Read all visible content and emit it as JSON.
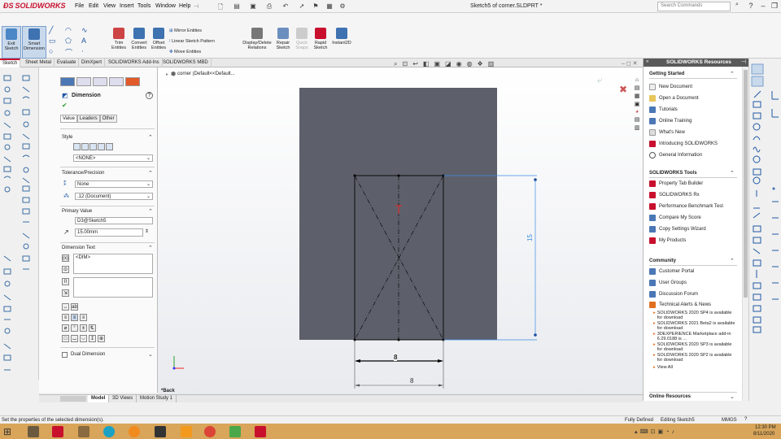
{
  "app": {
    "logo_text": "SOLIDWORKS",
    "menu": [
      "File",
      "Edit",
      "View",
      "Insert",
      "Tools",
      "Window",
      "Help"
    ],
    "document_title": "Sketch5 of corner.SLDPRT *",
    "search_placeholder": "Search Commands"
  },
  "ribbon": {
    "exit_sketch": "Exit Sketch",
    "smart_dimension": "Smart Dimension",
    "trim_entities": "Trim Entities",
    "convert_entities": "Convert Entities",
    "offset_entities": "Offset Entities",
    "mirror_entities": "Mirror Entities",
    "linear_pattern": "Linear Sketch Pattern",
    "move_entities": "Move Entities",
    "display_delete_relations": "Display/Delete Relations",
    "repair_sketch": "Repair Sketch",
    "quick_snaps": "Quick Snaps",
    "rapid_sketch": "Rapid Sketch",
    "instant2d": "Instant2D"
  },
  "cmd_tabs": [
    "Sketch",
    "Sheet Metal",
    "Evaluate",
    "DimXpert",
    "SOLIDWORKS Add-Ins",
    "SOLIDWORKS MBD"
  ],
  "tree_header": "corner (Default<<Default...",
  "property_manager": {
    "title": "Dimension",
    "tabs": [
      "Value",
      "Leaders",
      "Other"
    ],
    "style_label": "Style",
    "style_value": "<NONE>",
    "tolerance_label": "Tolerance/Precision",
    "tolerance_value": "None",
    "precision_value": ".12 (Document)",
    "primary_value_label": "Primary Value",
    "primary_name": "D3@Sketch5",
    "primary_value": "15.00mm",
    "dimension_text_label": "Dimension Text",
    "dim_text_value": "<DIM>",
    "dual_dimension_label": "Dual Dimension"
  },
  "sketch": {
    "dim_width_top": "8",
    "dim_width_bottom": "8",
    "dim_height": "15",
    "view_label": "*Back"
  },
  "bottom_tabs": [
    "Model",
    "3D Views",
    "Motion Study 1"
  ],
  "resources": {
    "title": "SOLIDWORKS Resources",
    "getting_started": {
      "heading": "Getting Started",
      "items": [
        "New Document",
        "Open a Document",
        "Tutorials",
        "Online Training",
        "What's New",
        "Introducing SOLIDWORKS",
        "General Information"
      ]
    },
    "tools": {
      "heading": "SOLIDWORKS Tools",
      "items": [
        "Property Tab Builder",
        "SOLIDWORKS Rx",
        "Performance Benchmark Test",
        "Compare My Score",
        "Copy Settings Wizard",
        "My Products"
      ]
    },
    "community": {
      "heading": "Community",
      "items": [
        "Customer Portal",
        "User Groups",
        "Discussion Forum",
        "Technical Alerts & News"
      ],
      "news": [
        "SOLIDWORKS 2020 SP4 is available for download",
        "SOLIDWORKS 2021 Beta2 is available for download",
        "3DEXPERIENCE Marketplace add-in 6.29.0188 is ...",
        "SOLIDWORKS 2020 SP3 is available for download",
        "SOLIDWORKS 2020 SP2 is available for download"
      ],
      "view_all": "View All"
    },
    "online": {
      "heading": "Online Resources"
    }
  },
  "status": {
    "message": "Set the properties of the selected dimension(s).",
    "defined": "Fully Defined",
    "editing": "Editing Sketch5",
    "units": "MMGS"
  },
  "taskbar": {
    "time": "12:30 PM",
    "date": "8/11/2020",
    "taskbar_color": "#d8a55a"
  },
  "colors": {
    "brand": "#c8102e",
    "part_face": "#5d606b",
    "sketch_line": "#0a0a0a",
    "dim_selected": "#3a8ee6"
  }
}
